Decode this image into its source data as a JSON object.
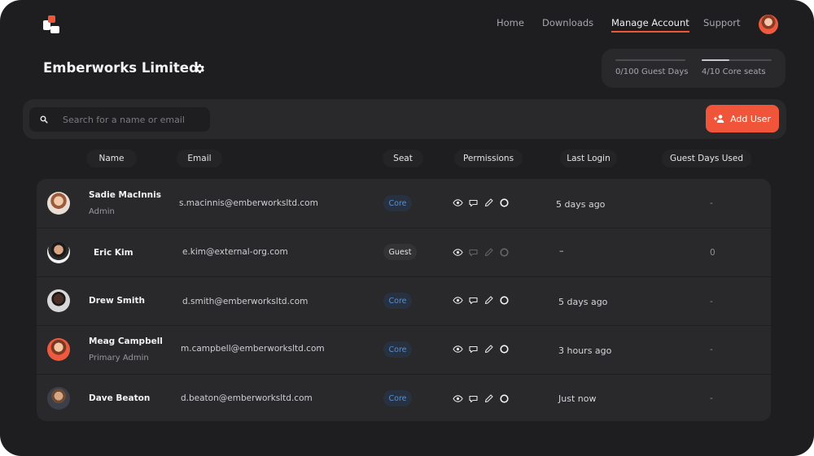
{
  "nav": {
    "home": "Home",
    "downloads": "Downloads",
    "manage_account": "Manage Account",
    "support": "Support"
  },
  "company": {
    "name": "Emberworks Limited"
  },
  "quota": {
    "guest_days": {
      "label": "0/100 Guest Days",
      "used": 0,
      "total": 100
    },
    "core_seats": {
      "label": "4/10 Core seats",
      "used": 4,
      "total": 10
    }
  },
  "search": {
    "placeholder": "Search for a name or email"
  },
  "add_user": {
    "label": "Add User"
  },
  "columns": {
    "name": "Name",
    "email": "Email",
    "seat": "Seat",
    "permissions": "Permissions",
    "last_login": "Last Login",
    "guest_days_used": "Guest Days Used"
  },
  "users": [
    {
      "name": "Sadie MacInnis",
      "role": "Admin",
      "email": "s.macinnis@emberworksltd.com",
      "seat": "Core",
      "last_login": "5 days ago",
      "guest_days_used": "-"
    },
    {
      "name": "Eric Kim",
      "role": "",
      "email": "e.kim@external-org.com",
      "seat": "Guest",
      "last_login": "–",
      "guest_days_used": "0"
    },
    {
      "name": "Drew Smith",
      "role": "",
      "email": "d.smith@emberworksltd.com",
      "seat": "Core",
      "last_login": "5 days ago",
      "guest_days_used": "-"
    },
    {
      "name": "Meag Campbell",
      "role": "Primary Admin",
      "email": "m.campbell@emberworksltd.com",
      "seat": "Core",
      "last_login": "3 hours ago",
      "guest_days_used": "-"
    },
    {
      "name": "Dave Beaton",
      "role": "",
      "email": "d.beaton@emberworksltd.com",
      "seat": "Core",
      "last_login": "Just now",
      "guest_days_used": "-"
    }
  ],
  "icons": {
    "logo": "logo-icon",
    "settings": "gear-icon",
    "search": "search-icon",
    "add_user": "add-user-icon",
    "view": "eye-icon",
    "comment": "comment-icon",
    "edit": "pencil-icon",
    "status": "circle-icon"
  },
  "colors": {
    "accent": "#f0553a",
    "core_badge_text": "#5a8fd3",
    "core_badge_bg": "#27313f",
    "background": "#1e1e20"
  }
}
